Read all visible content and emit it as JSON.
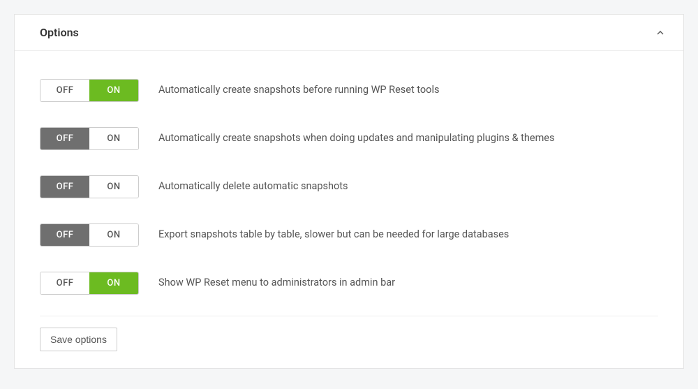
{
  "panel": {
    "title": "Options",
    "collapsed": false
  },
  "toggle_labels": {
    "off": "OFF",
    "on": "ON"
  },
  "options": [
    {
      "id": "auto-snapshot-tools",
      "value": "on",
      "label": "Automatically create snapshots before running WP Reset tools"
    },
    {
      "id": "auto-snapshot-updates",
      "value": "off",
      "label": "Automatically create snapshots when doing updates and manipulating plugins & themes"
    },
    {
      "id": "auto-delete-snapshots",
      "value": "off",
      "label": "Automatically delete automatic snapshots"
    },
    {
      "id": "export-table-by-table",
      "value": "off",
      "label": "Export snapshots table by table, slower but can be needed for large databases"
    },
    {
      "id": "show-admin-bar-menu",
      "value": "on",
      "label": "Show WP Reset menu to administrators in admin bar"
    }
  ],
  "buttons": {
    "save": "Save options"
  },
  "colors": {
    "accent_on": "#6cbb21",
    "accent_off": "#6f6f6f"
  }
}
